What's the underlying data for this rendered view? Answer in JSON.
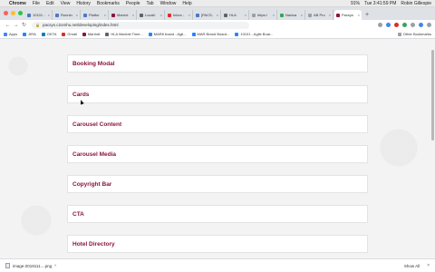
{
  "menubar": {
    "app": "Chrome",
    "items": [
      "File",
      "Edit",
      "View",
      "History",
      "Bookmarks",
      "People",
      "Tab",
      "Window",
      "Help"
    ],
    "status": {
      "battery": "91%",
      "clock": "Tue 3:41:59 PM",
      "user": "Robin Gillespie"
    }
  },
  "tabs": [
    {
      "label": "10101 -"
    },
    {
      "label": "Runnin"
    },
    {
      "label": "Platfor"
    },
    {
      "label": "Marriot"
    },
    {
      "label": "Locali:"
    },
    {
      "label": "Inbox -"
    },
    {
      "label": "[PACS-"
    },
    {
      "label": "HLA"
    },
    {
      "label": "https:/"
    },
    {
      "label": "Naviza"
    },
    {
      "label": "AB Pro"
    },
    {
      "label": "Pacsys",
      "active": true
    }
  ],
  "toolbar": {
    "url": "pacsys.c2omhu.net/developing/index.html"
  },
  "bookmarks": [
    {
      "label": "Apps",
      "color": "#4285f4"
    },
    {
      "label": "JIRA",
      "color": "#2684ff"
    },
    {
      "label": "OKTA",
      "color": "#007dc1"
    },
    {
      "label": "Gmail",
      "color": "#d93025"
    },
    {
      "label": "Marriott",
      "color": "#8a1538"
    },
    {
      "label": "HLA Marriott Time...",
      "color": "#5f6368"
    },
    {
      "label": "MAR8 board - Agil...",
      "color": "#2684ff"
    },
    {
      "label": "MAR Brand Board...",
      "color": "#2684ff"
    },
    {
      "label": "10101 - Agile Boar...",
      "color": "#2684ff"
    }
  ],
  "other_bookmarks": "Other Bookmarks",
  "components": [
    "Booking Modal",
    "Cards",
    "Carousel Content",
    "Carousel Media",
    "Copyright Bar",
    "CTA",
    "Hotel Directory"
  ],
  "downloads": {
    "file": "image-2019111....png",
    "show_all": "Show All"
  },
  "colors": {
    "accent": "#8a1538",
    "page_bg": "#f3f3f3"
  }
}
